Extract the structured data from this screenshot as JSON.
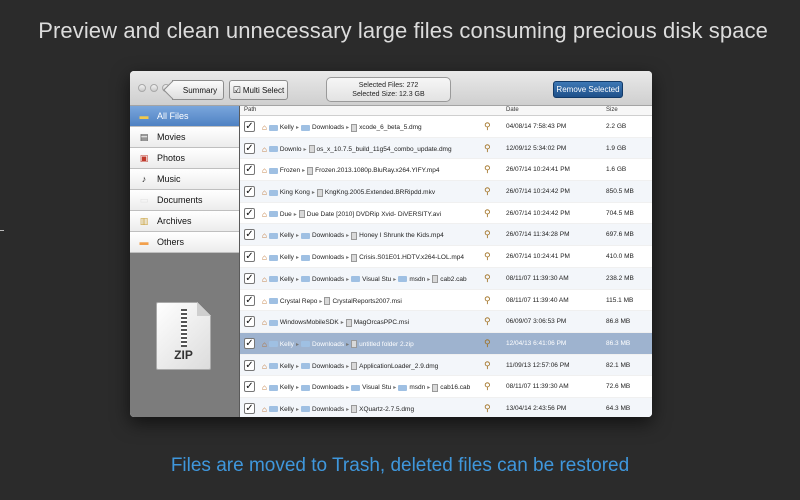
{
  "headline": "Preview and clean unnecessary large files consuming precious disk space",
  "footline": "Files are moved to Trash, deleted files can be restored",
  "toolbar": {
    "summary_label": "Summary",
    "multi_select_label": "Multi Select",
    "selected_files": "Selected Files: 272",
    "selected_size": "Selected Size: 12.3 GB",
    "remove_label": "Remove Selected"
  },
  "sidebar": {
    "items": [
      {
        "label": "All Files",
        "icon": "folder-icon",
        "color": "#f2c94c"
      },
      {
        "label": "Movies",
        "icon": "film-icon",
        "color": "#3a3a3a"
      },
      {
        "label": "Photos",
        "icon": "photo-icon",
        "color": "#c0392b"
      },
      {
        "label": "Music",
        "icon": "music-icon",
        "color": "#222222"
      },
      {
        "label": "Documents",
        "icon": "document-icon",
        "color": "#e0e0e0"
      },
      {
        "label": "Archives",
        "icon": "archive-icon",
        "color": "#c9a23d"
      },
      {
        "label": "Others",
        "icon": "folder-icon",
        "color": "#f2a04c"
      }
    ],
    "preview_label": "ZIP"
  },
  "table": {
    "columns": [
      "Path",
      "Date",
      "Size"
    ],
    "rows": [
      {
        "path": [
          "Kelly",
          "Downloads",
          "xcode_6_beta_5.dmg"
        ],
        "date": "04/08/14 7:58:43 PM",
        "size": "2.2 GB"
      },
      {
        "path": [
          "Downlo",
          "os_x_10.7.5_build_11g54_combo_update.dmg"
        ],
        "date": "12/09/12 5:34:02 PM",
        "size": "1.9 GB"
      },
      {
        "path": [
          "Frozen",
          "Frozen.2013.1080p.BluRay.x264.YIFY.mp4"
        ],
        "date": "26/07/14 10:24:41 PM",
        "size": "1.6 GB"
      },
      {
        "path": [
          "King Kong",
          "KngKng.2005.Extended.BRRipdd.mkv"
        ],
        "date": "26/07/14 10:24:42 PM",
        "size": "850.5 MB"
      },
      {
        "path": [
          "Due",
          "Due Date [2010] DVDRip Xvid- DiVERSITY.avi"
        ],
        "date": "26/07/14 10:24:42 PM",
        "size": "704.5 MB"
      },
      {
        "path": [
          "Kelly",
          "Downloads",
          "Honey I Shrunk the Kids.mp4"
        ],
        "date": "26/07/14 11:34:28 PM",
        "size": "697.6 MB"
      },
      {
        "path": [
          "Kelly",
          "Downloads",
          "Crisis.S01E01.HDTV.x264-LOL.mp4"
        ],
        "date": "26/07/14 10:24:41 PM",
        "size": "410.0 MB"
      },
      {
        "path": [
          "Kelly",
          "Downloads",
          "Visual Stu",
          "msdn",
          "cab2.cab"
        ],
        "date": "08/11/07 11:39:30 AM",
        "size": "238.2 MB"
      },
      {
        "path": [
          "Crystal Repo",
          "CrystalReports2007.msi"
        ],
        "date": "08/11/07 11:39:40 AM",
        "size": "115.1 MB"
      },
      {
        "path": [
          "WindowsMobileSDK",
          "MagOrcasPPC.msi"
        ],
        "date": "06/09/07 3:06:53 PM",
        "size": "86.8 MB"
      },
      {
        "path": [
          "Kelly",
          "Downloads",
          "untitled folder 2.zip"
        ],
        "date": "12/04/13 6:41:06 PM",
        "size": "86.3 MB",
        "selected": true
      },
      {
        "path": [
          "Kelly",
          "Downloads",
          "ApplicationLoader_2.9.dmg"
        ],
        "date": "11/09/13 12:57:06 PM",
        "size": "82.1 MB"
      },
      {
        "path": [
          "Kelly",
          "Downloads",
          "Visual Stu",
          "msdn",
          "cab16.cab"
        ],
        "date": "08/11/07 11:39:30 AM",
        "size": "72.6 MB"
      },
      {
        "path": [
          "Kelly",
          "Downloads",
          "XQuartz-2.7.5.dmg"
        ],
        "date": "13/04/14 2:43:56 PM",
        "size": "64.3 MB"
      }
    ]
  },
  "colors": {
    "accent": "#3f97dc",
    "selection": "#9eb3cf",
    "remove_button": "#2a5f9c"
  }
}
